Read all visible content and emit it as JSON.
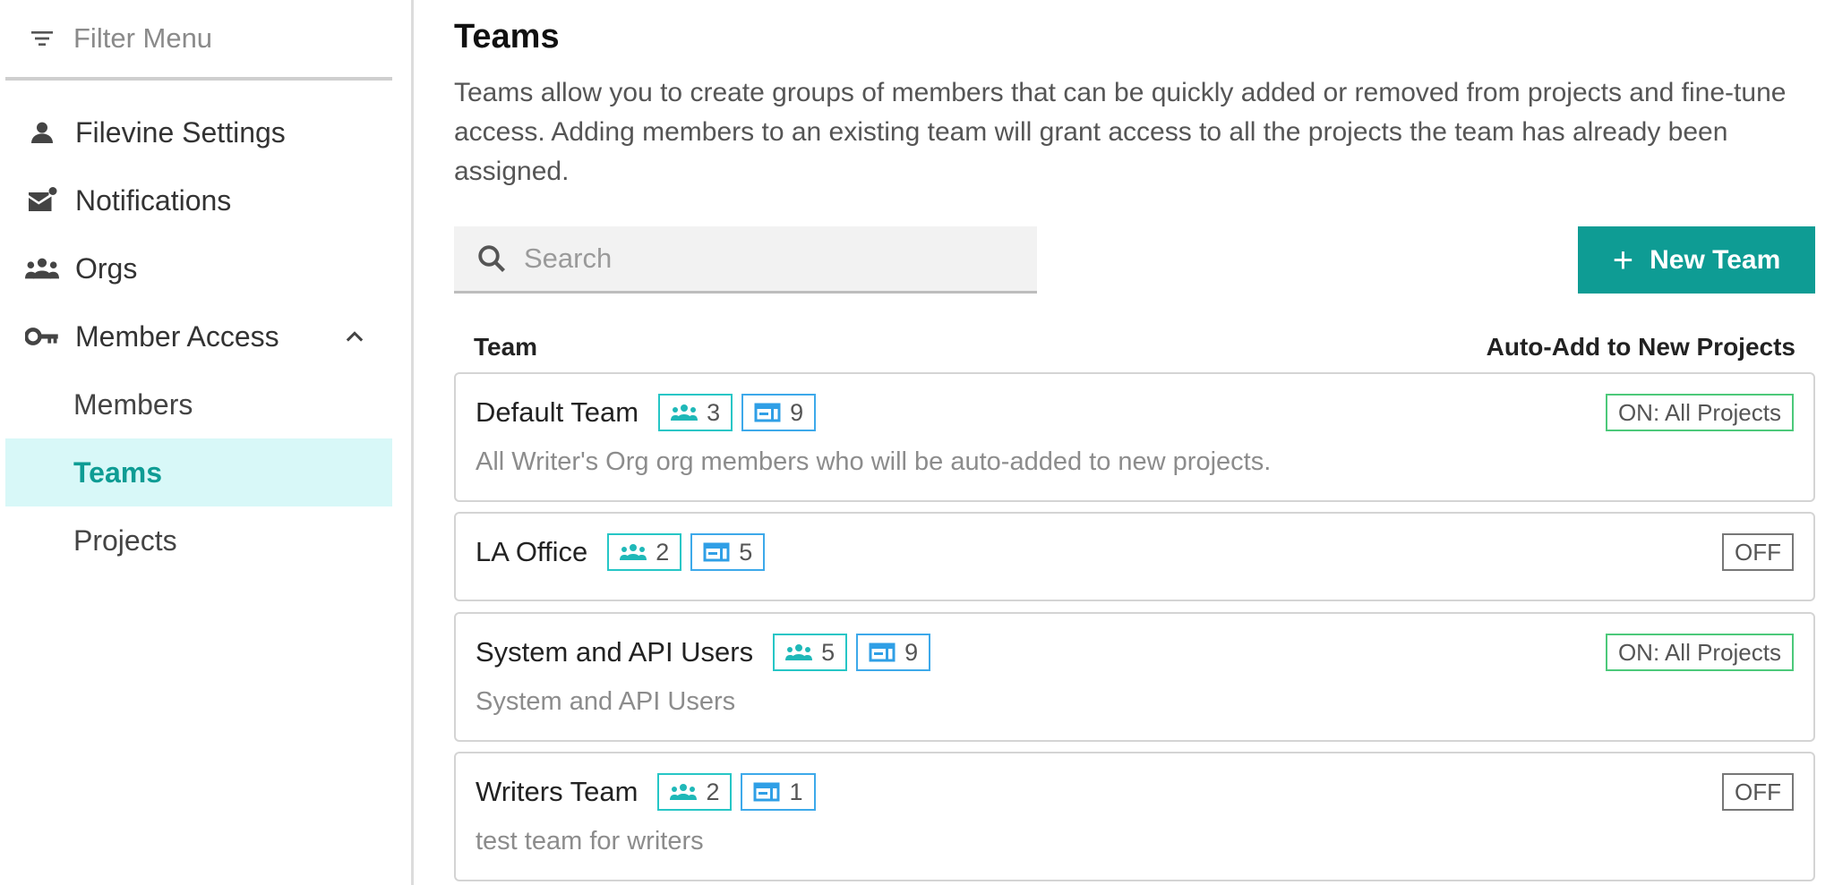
{
  "sidebar": {
    "filter_placeholder": "Filter Menu",
    "items": [
      {
        "label": "Filevine Settings",
        "icon": "person-icon"
      },
      {
        "label": "Notifications",
        "icon": "mail-notification-icon"
      },
      {
        "label": "Orgs",
        "icon": "group-icon"
      },
      {
        "label": "Member Access",
        "icon": "key-icon",
        "expanded": true
      }
    ],
    "sub_items": [
      {
        "label": "Members",
        "active": false
      },
      {
        "label": "Teams",
        "active": true
      },
      {
        "label": "Projects",
        "active": false
      }
    ]
  },
  "main": {
    "title": "Teams",
    "description": "Teams allow you to create groups of members that can be quickly added or removed from projects and fine-tune access. Adding members to an existing team will grant access to all the projects the team has already been assigned.",
    "search_placeholder": "Search",
    "new_team_label": "New Team",
    "col_team": "Team",
    "col_auto_add": "Auto-Add to New Projects",
    "teams": [
      {
        "name": "Default Team",
        "members": "3",
        "projects": "9",
        "description": "All Writer's Org org members who will be auto-added to new projects.",
        "auto_add": "ON: All Projects"
      },
      {
        "name": "LA Office",
        "members": "2",
        "projects": "5",
        "description": "",
        "auto_add": "OFF"
      },
      {
        "name": "System and API Users",
        "members": "5",
        "projects": "9",
        "description": "System and API Users",
        "auto_add": "ON: All Projects"
      },
      {
        "name": "Writers Team",
        "members": "2",
        "projects": "1",
        "description": "test team for writers",
        "auto_add": "OFF"
      }
    ]
  },
  "colors": {
    "accent": "#0e9c94",
    "active_bg": "#d8f8f8",
    "members_chip": "#26c6c6",
    "projects_chip": "#3da9ea",
    "on_badge": "#4cc97a"
  }
}
